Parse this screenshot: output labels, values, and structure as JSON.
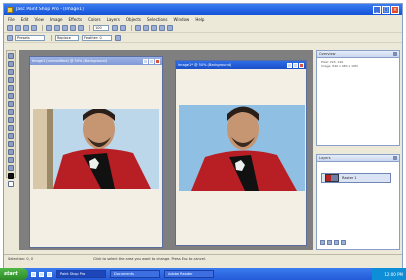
{
  "app": {
    "title": "Jasc Paint Shop Pro - [Image1]",
    "window_controls": [
      "_",
      "□",
      "×"
    ]
  },
  "menubar": [
    "File",
    "Edit",
    "View",
    "Image",
    "Effects",
    "Colors",
    "Layers",
    "Objects",
    "Selections",
    "Window",
    "Help"
  ],
  "toolbar": {
    "zoom_value": "100",
    "preset_label": "Presets",
    "mode_label": "Replace",
    "feather_label": "Feather: 0"
  },
  "documents": [
    {
      "title": "Image1 (unmodified) @ 50% (Background)",
      "state": "inactive"
    },
    {
      "title": "Image1* @ 50% (Background)",
      "state": "active"
    }
  ],
  "panels": {
    "overview": {
      "title": "Overview",
      "text": "Pixel: 225, 190\nImage: 640 x 480 x 16M"
    },
    "layers": {
      "title": "Layers",
      "layer_name": "Raster 1"
    }
  },
  "statusbar": {
    "left": "Selection: 0, 0",
    "center": "Click to select the area you want to change. Press Esc to cancel."
  },
  "taskbar": {
    "start_label": "start",
    "tasks": [
      {
        "label": "Paint Shop Pro",
        "active": true
      },
      {
        "label": "Documents",
        "active": false
      },
      {
        "label": "Adobe Reader",
        "active": false
      }
    ],
    "clock": "12:00 PM"
  },
  "colors": {
    "titlebar": "#1352d8",
    "workspace": "#7f7f7f",
    "taskbar": "#245ad6",
    "start": "#2d8a27"
  }
}
